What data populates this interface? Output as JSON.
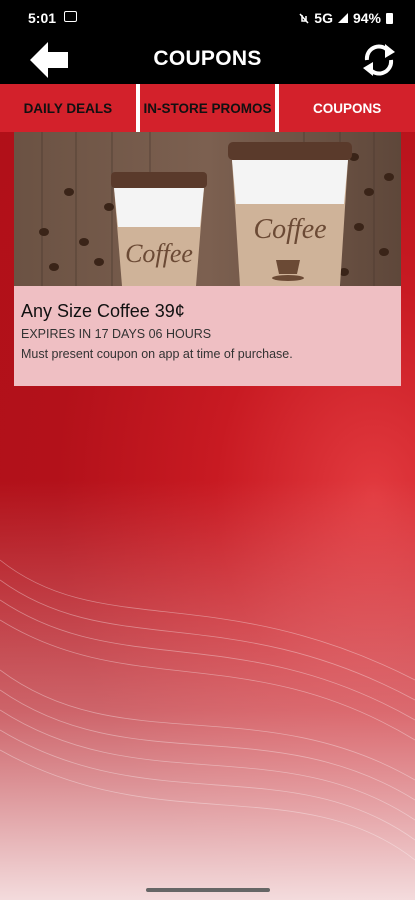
{
  "status_bar": {
    "time": "5:01",
    "network": "5G",
    "battery": "94%"
  },
  "header": {
    "title": "COUPONS",
    "back_icon": "arrow-left-icon",
    "refresh_icon": "refresh-icon"
  },
  "tabs": [
    {
      "label": "DAILY DEALS",
      "active": false
    },
    {
      "label": "IN-STORE PROMOS",
      "active": false
    },
    {
      "label": "COUPONS",
      "active": true
    }
  ],
  "coupons": [
    {
      "cup_label": "Coffee",
      "title": "Any Size Coffee 39¢",
      "expiry": "EXPIRES IN 17 DAYS 06 HOURS",
      "note": "Must present coupon on app at time of purchase."
    }
  ],
  "colors": {
    "accent_red": "#d3212b",
    "header_black": "#000000",
    "card_pink": "#efbfc3"
  }
}
